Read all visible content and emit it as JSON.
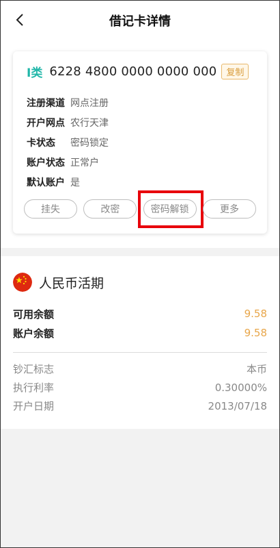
{
  "header": {
    "title": "借记卡详情",
    "back_icon": "chevron-left-icon"
  },
  "card": {
    "type_label": "I类",
    "number": "6228 4800 0000 0000 000",
    "copy_label": "复制",
    "info": [
      {
        "label": "注册渠道",
        "value": "网点注册"
      },
      {
        "label": "开户网点",
        "value": "农行天津"
      },
      {
        "label": "卡状态",
        "value": "密码锁定"
      },
      {
        "label": "账户状态",
        "value": "正常户"
      },
      {
        "label": "默认账户",
        "value": "是"
      }
    ],
    "actions": [
      {
        "label": "挂失"
      },
      {
        "label": "改密"
      },
      {
        "label": "密码解锁"
      },
      {
        "label": "更多"
      }
    ]
  },
  "account": {
    "flag_icon": "china-flag-icon",
    "title": "人民币活期",
    "balances": [
      {
        "label": "可用余额",
        "value": "9.58"
      },
      {
        "label": "账户余额",
        "value": "9.58"
      }
    ],
    "meta": [
      {
        "label": "钞汇标志",
        "value": "本币"
      },
      {
        "label": "执行利率",
        "value": "0.30000%"
      },
      {
        "label": "开户日期",
        "value": "2013/07/18"
      }
    ]
  },
  "colors": {
    "accent_teal": "#1fb6a8",
    "accent_orange": "#e8a64a",
    "highlight_red": "#e8000b"
  }
}
